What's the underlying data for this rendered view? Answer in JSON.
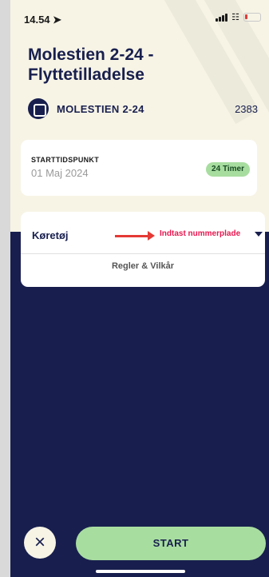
{
  "status_bar": {
    "time": "14.54 ➤"
  },
  "header": {
    "title": "Molestien 2-24 - Flyttetilladelse",
    "zone_name": "MOLESTIEN 2-24",
    "zone_code": "2383"
  },
  "start_card": {
    "label": "STARTTIDSPUNKT",
    "date": "01 Maj 2024",
    "duration_badge": "24 Timer"
  },
  "vehicle_card": {
    "label": "Køretøj",
    "plate_prompt": "Indtast nummerplade",
    "terms_link": "Regler & Vilkår"
  },
  "footer": {
    "close_icon": "×",
    "start_label": "START"
  },
  "colors": {
    "navy": "#181f4e",
    "cream": "#f7f4e6",
    "green": "#a8dda0",
    "alert_pink": "#e8174f",
    "arrow_red": "#e53935"
  }
}
